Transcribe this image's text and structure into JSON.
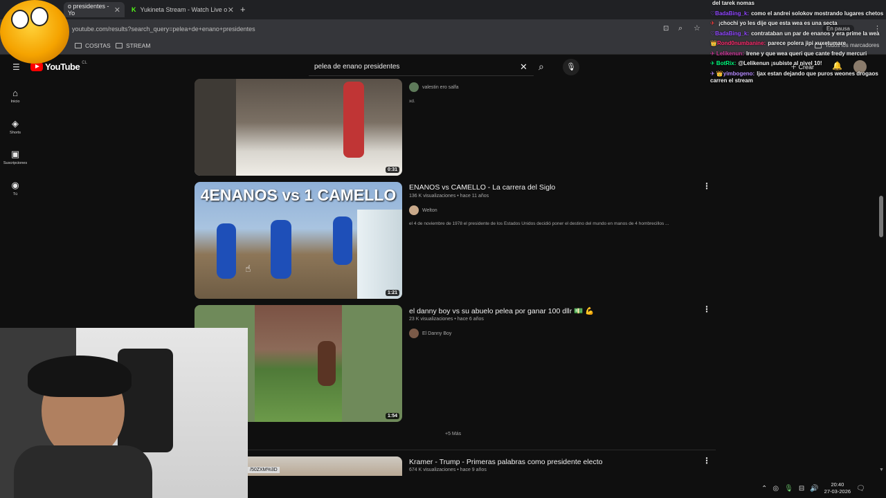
{
  "browser": {
    "tabs": [
      {
        "label": "o presidentes - Yo",
        "close": "✕"
      },
      {
        "label": "Yukineta Stream - Watch Live o",
        "close": "✕"
      }
    ],
    "new_tab": "+",
    "url": "youtube.com/results?search_query=pelea+de+enano+presidentes",
    "bookmarks": [
      "COSITAS",
      "STREAM"
    ],
    "all_bookmarks": "Todos los marcadores",
    "paused": "En pausa"
  },
  "youtube": {
    "logo": "YouTube",
    "country": "CL",
    "search_query": "pelea de enano presidentes",
    "create_label": "Crear",
    "sidebar": [
      {
        "label": "Inicio",
        "icon": "⌂"
      },
      {
        "label": "Shorts",
        "icon": "◈"
      },
      {
        "label": "Suscripciones",
        "icon": "▣"
      },
      {
        "label": "Tú",
        "icon": "◉"
      }
    ],
    "results": [
      {
        "title": "",
        "channel": "valestin ero salfa",
        "desc": "xd.",
        "duration": "0:31"
      },
      {
        "title": "ENANOS vs CAMELLO - La carrera del Siglo",
        "views": "136 K visualizaciones",
        "age": "hace 11 años",
        "channel": "Welton",
        "desc": "el 4 de noviembre de 1978 el presidente de los Estados Unidos decidió poner el destino del mundo en manos de 4 hombrecillos ...",
        "duration": "1:21",
        "thumb_text": "4ENANOS vs 1 CAMELLO"
      },
      {
        "title": "el danny boy vs su abuelo pelea por ganar 100 dllr 💵 💪",
        "views": "23 K visualizaciones",
        "age": "hace 6 años",
        "channel": "El Danny Boy",
        "duration": "1:54"
      },
      {
        "title": "Kramer - Trump - Primeras palabras como presidente electo",
        "views": "674 K visualizaciones",
        "age": "hace 9 años"
      }
    ],
    "more_label": "+5 Más",
    "url_fragment": "/50ZXM%3D"
  },
  "chat": [
    {
      "user": "",
      "text": "del tarek nomas",
      "color": "#f1f1f1"
    },
    {
      "user": "♡BadaBing_k:",
      "text": "como el andrei solokov mostrando lugares chetos",
      "color": "#9147ff"
    },
    {
      "user": "✈ ",
      "text": "¡chochi yo les dije que esta wea es una secta",
      "color": "#ff4040"
    },
    {
      "user": "♡BadaBing_k:",
      "text": "contrataban un par de enanos y era prime la wea",
      "color": "#9147ff"
    },
    {
      "user": "👑Rond0numbanine:",
      "text": "parece polera jipi xuxetumare",
      "color": "#ff2a6d"
    },
    {
      "user": "✈ Lelikenun:",
      "text": "Irene y que wea queri que cante fredy mercuri",
      "color": "#d0389b"
    },
    {
      "user": "✈ BotRix:",
      "text": "@Lelikenun ¡subiste al nivel 10!",
      "color": "#00ff7f"
    },
    {
      "user": "✈ 👑yimbogeno:",
      "text": "ljax estan dejando que puros weones drogaos carren el stream",
      "color": "#b68cff"
    }
  ],
  "tray": {
    "time": "20:40",
    "date": "27-03-2026"
  }
}
